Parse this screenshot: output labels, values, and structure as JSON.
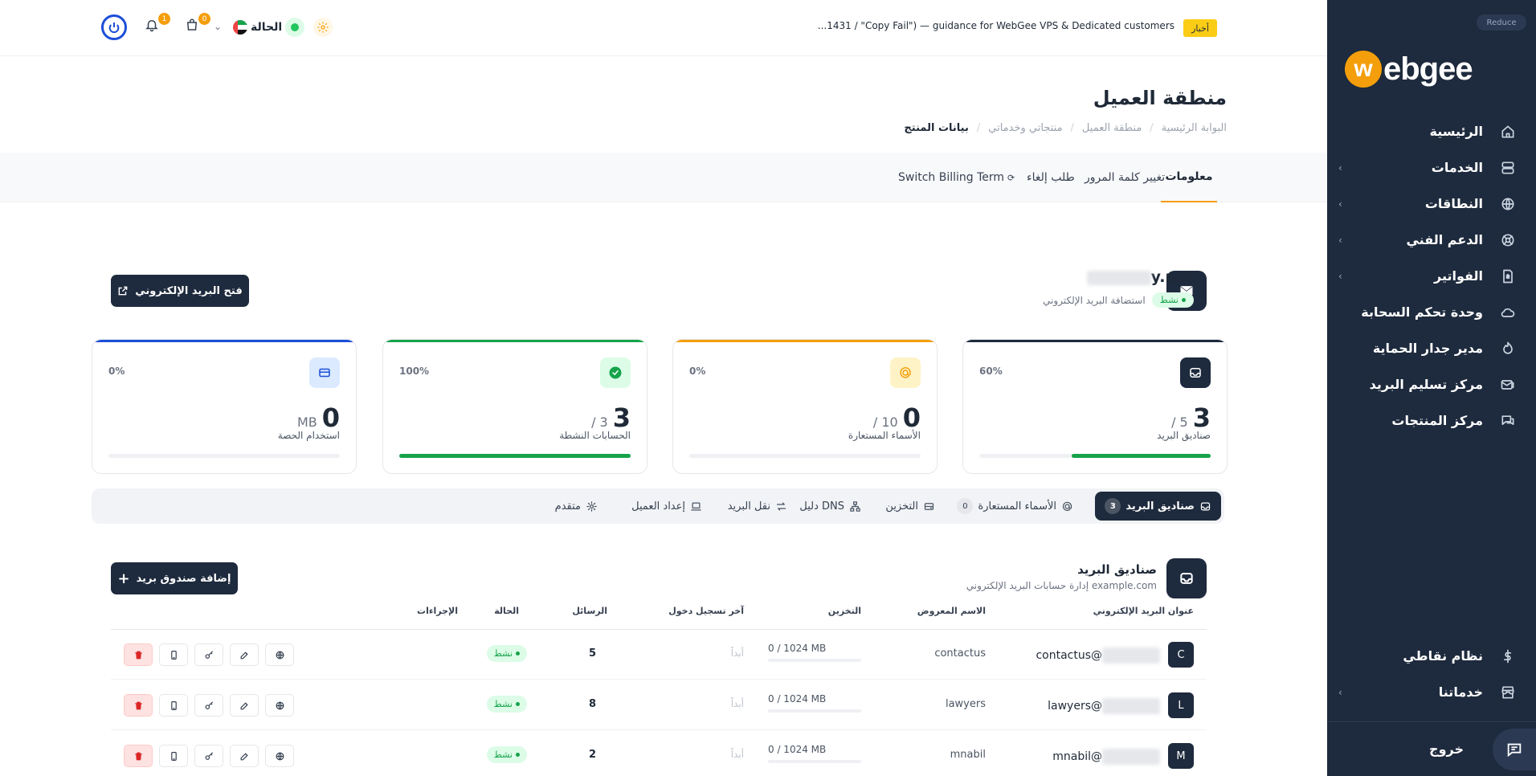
{
  "sidebar": {
    "reduce_label": "Reduce",
    "logo_letter": "w",
    "logo_text": "ebgee",
    "items": [
      {
        "label": "الرئيسية",
        "icon": "home-icon",
        "chevron": false
      },
      {
        "label": "الخدمات",
        "icon": "server-icon",
        "chevron": true
      },
      {
        "label": "النطاقات",
        "icon": "globe-icon",
        "chevron": true
      },
      {
        "label": "الدعم الفني",
        "icon": "lifebuoy-icon",
        "chevron": true
      },
      {
        "label": "الفواتير",
        "icon": "invoice-icon",
        "chevron": true
      },
      {
        "label": "وحدة تحكم السحابة",
        "icon": "cloud-icon",
        "chevron": false
      },
      {
        "label": "مدير جدار الحماية",
        "icon": "firewall-icon",
        "chevron": false
      },
      {
        "label": "مركز تسليم البريد",
        "icon": "mail-delivery-icon",
        "chevron": false
      },
      {
        "label": "مركز المنتجات",
        "icon": "chat-icon",
        "chevron": false
      }
    ],
    "bottom_items": [
      {
        "label": "نظام نقاطي",
        "icon": "dollar-icon",
        "chevron": false
      },
      {
        "label": "خدماتنا",
        "icon": "store-icon",
        "chevron": true
      }
    ],
    "logout_label": "خروج"
  },
  "topbar": {
    "news_badge": "أخبار",
    "news_text": "...1431 / \"Copy Fail\") — guidance for WebGee VPS & Dedicated customers",
    "status_label": "الحالة",
    "cart_count": "0",
    "bell_count": "1"
  },
  "page": {
    "title": "منطقة العميل",
    "breadcrumb": [
      "البوابة الرئيسية",
      "منطقة العميل",
      "منتجاتي وخدماتي",
      "بيانات المنتج"
    ]
  },
  "tabs": [
    "معلومات",
    "تغيير كلمة المرور",
    "طلب إلغاء",
    "Switch Billing Term"
  ],
  "product": {
    "name_suffix": "y.net",
    "status": "نشط",
    "type": "استضافة البريد الإلكتروني",
    "open_mail_label": "فتح البريد الإلكتروني"
  },
  "stats": [
    {
      "label": "صناديق البريد",
      "value": "3",
      "total": "/ 5",
      "pct": "60%",
      "fill": 0.6,
      "color": "#1e2a3d",
      "icon_bg": "#1e2a3d",
      "icon": "inbox-icon"
    },
    {
      "label": "الأسماء المستعارة",
      "value": "0",
      "total": "/ 10",
      "pct": "0%",
      "fill": 0,
      "color": "#f59e0b",
      "icon_bg": "#fef3c7",
      "icon": "at-icon"
    },
    {
      "label": "الحسابات النشطة",
      "value": "3",
      "total": "/ 3",
      "pct": "100%",
      "fill": 1,
      "color": "#16a34a",
      "icon_bg": "#dcfce7",
      "icon": "check-circle-icon"
    },
    {
      "label": "استخدام الحصة",
      "value": "0",
      "total": "MB",
      "pct": "0%",
      "fill": 0,
      "color": "#1d4ed8",
      "icon_bg": "#dbeafe",
      "icon": "storage-icon"
    }
  ],
  "subtabs": [
    {
      "label": "صناديق البريد",
      "count": "3",
      "icon": "inbox-icon"
    },
    {
      "label": "الأسماء المستعارة",
      "count": "0",
      "icon": "at-icon"
    },
    {
      "label": "التخزين",
      "count": "",
      "icon": "hdd-icon"
    },
    {
      "label": "دليل DNS",
      "count": "",
      "icon": "sitemap-icon"
    },
    {
      "label": "نقل البريد",
      "count": "",
      "icon": "swap-icon"
    },
    {
      "label": "إعداد العميل",
      "count": "",
      "icon": "laptop-icon"
    },
    {
      "label": "متقدم",
      "count": "",
      "icon": "gear-icon"
    }
  ],
  "mailboxes": {
    "title": "صناديق البريد",
    "subtitle": "إدارة حسابات البريد الإلكتروني example.com",
    "add_label": "إضافة صندوق بريد",
    "columns": [
      "عنوان البريد الإلكتروني",
      "الاسم المعروض",
      "التخزين",
      "آخر تسجيل دخول",
      "الرسائل",
      "الحالة",
      "الإجراءات"
    ],
    "rows": [
      {
        "initial": "C",
        "email": "contactus@",
        "display": "contactus",
        "storage": "0 / 1024 MB",
        "last_login": "أبداً",
        "messages": "5",
        "status": "نشط"
      },
      {
        "initial": "L",
        "email": "lawyers@",
        "display": "lawyers",
        "storage": "0 / 1024 MB",
        "last_login": "أبداً",
        "messages": "8",
        "status": "نشط"
      },
      {
        "initial": "M",
        "email": "mnabil@",
        "display": "mnabil",
        "storage": "0 / 1024 MB",
        "last_login": "أبداً",
        "messages": "2",
        "status": "نشط"
      }
    ]
  }
}
